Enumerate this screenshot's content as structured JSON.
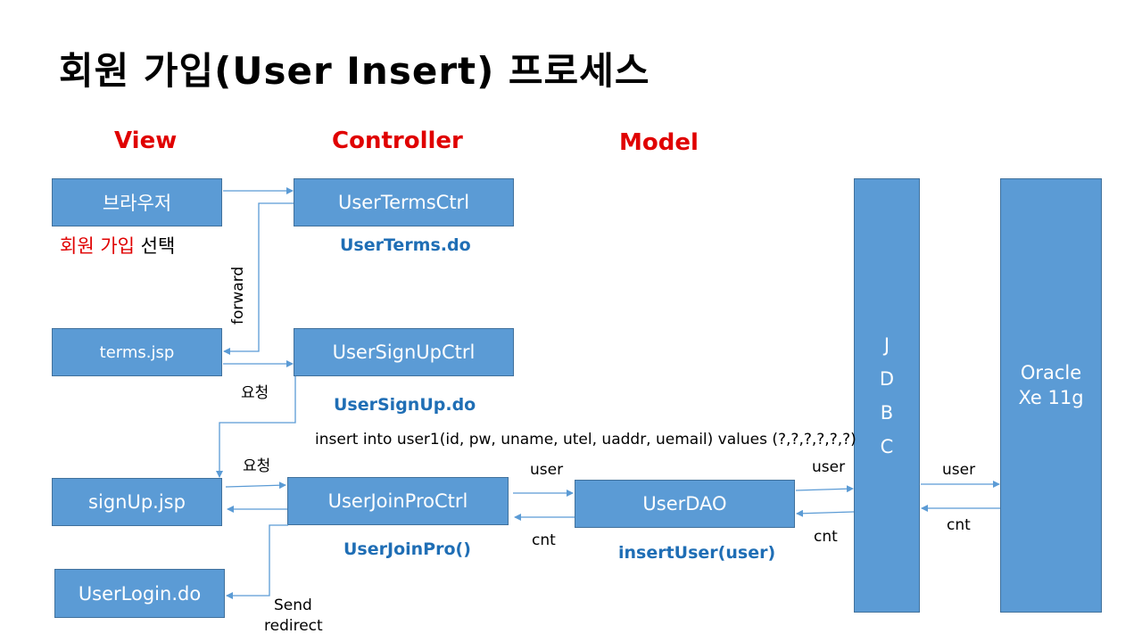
{
  "title": "회원 가입(User Insert) 프로세스",
  "headers": {
    "view": "View",
    "controller": "Controller",
    "model": "Model"
  },
  "boxes": {
    "browser": "브라우저",
    "terms_jsp": "terms.jsp",
    "signup_jsp": "signUp.jsp",
    "user_login": "UserLogin.do",
    "user_terms_ctrl": "UserTermsCtrl",
    "user_signup_ctrl": "UserSignUpCtrl",
    "user_join_pro_ctrl": "UserJoinProCtrl",
    "user_dao": "UserDAO",
    "jdbc": [
      "J",
      "D",
      "B",
      "C"
    ],
    "oracle": [
      "Oracle",
      "Xe 11g"
    ]
  },
  "labels": {
    "signup_select_red": "회원 가입",
    "signup_select_black": "선택",
    "user_terms_do": "UserTerms.do",
    "user_signup_do": "UserSignUp.do",
    "user_join_pro": "UserJoinPro()",
    "insert_user": "insertUser(user)",
    "sql": "insert into user1(id, pw, uname, utel, uaddr, uemail) values (?,?,?,?,?,?)",
    "forward": "forward",
    "request_1": "요청",
    "request_2": "요청",
    "send_redirect_1": "Send",
    "send_redirect_2": "redirect",
    "user_1": "user",
    "cnt_1": "cnt",
    "user_2": "user",
    "cnt_2": "cnt",
    "user_3": "user",
    "cnt_3": "cnt"
  },
  "colors": {
    "box_fill": "#5b9bd5",
    "box_border": "#41719c",
    "heading_red": "#e00000",
    "label_blue": "#1f6eb5",
    "arrow": "#5b9bd5"
  }
}
